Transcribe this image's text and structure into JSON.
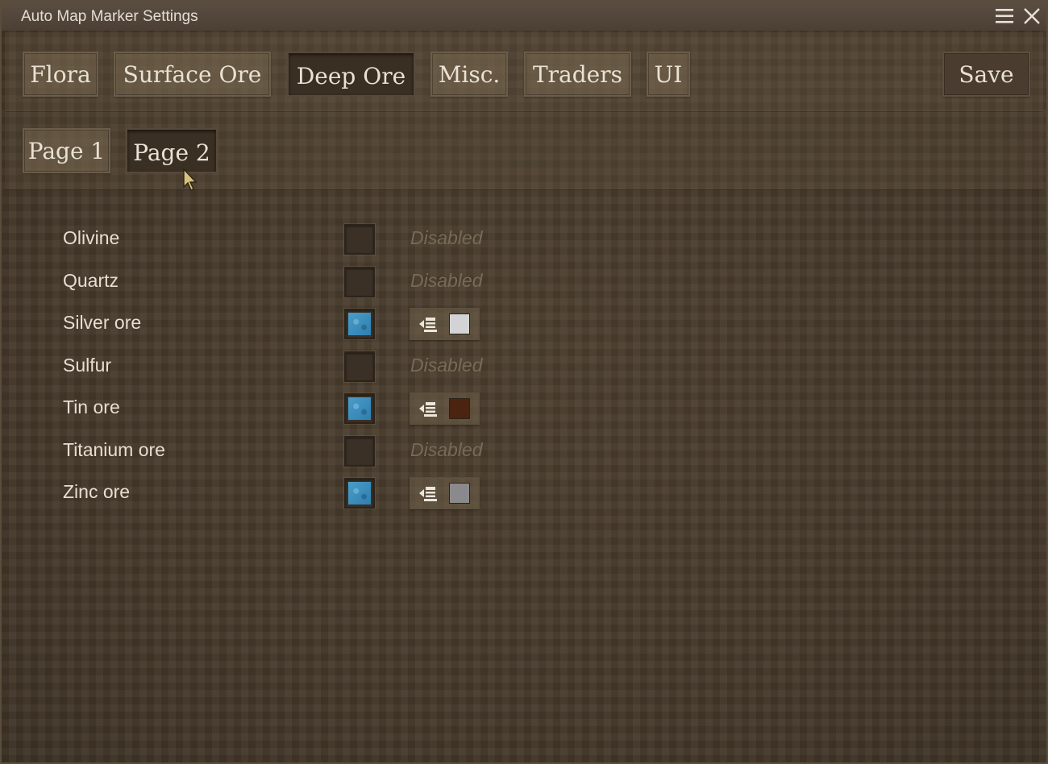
{
  "window": {
    "title": "Auto Map Marker Settings"
  },
  "titlebar_icons": [
    "menu-icon",
    "close-icon"
  ],
  "tabs": [
    {
      "label": "Flora",
      "active": false
    },
    {
      "label": "Surface Ore",
      "active": false
    },
    {
      "label": "Deep Ore",
      "active": true
    },
    {
      "label": "Misc.",
      "active": false
    },
    {
      "label": "Traders",
      "active": false
    },
    {
      "label": "UI",
      "active": false
    }
  ],
  "save_label": "Save",
  "pages": [
    {
      "label": "Page 1",
      "active": false
    },
    {
      "label": "Page 2",
      "active": true
    }
  ],
  "rows": [
    {
      "label": "Olivine",
      "enabled": false,
      "status": "Disabled"
    },
    {
      "label": "Quartz",
      "enabled": false,
      "status": "Disabled"
    },
    {
      "label": "Silver ore",
      "enabled": true,
      "icon": "waypoint-marker-icon",
      "color": "#d3d3d5"
    },
    {
      "label": "Sulfur",
      "enabled": false,
      "status": "Disabled"
    },
    {
      "label": "Tin ore",
      "enabled": true,
      "icon": "waypoint-marker-icon",
      "color": "#4a2410"
    },
    {
      "label": "Titanium ore",
      "enabled": false,
      "status": "Disabled"
    },
    {
      "label": "Zinc ore",
      "enabled": true,
      "icon": "waypoint-marker-icon",
      "color": "#8a8a8c"
    }
  ],
  "colors": {
    "checkbox_on": "#3d8fc0",
    "disabled_text": "#776a57"
  }
}
